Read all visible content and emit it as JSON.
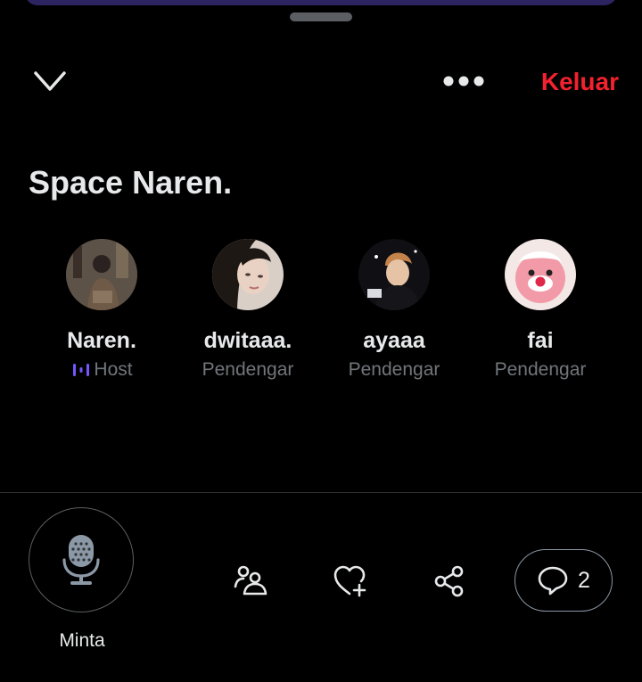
{
  "header": {
    "collapse_icon": "chevron-down-icon",
    "more_icon": "more-horizontal-icon",
    "leave_label": "Keluar",
    "leave_color": "#f4212e"
  },
  "space": {
    "title": "Space Naren."
  },
  "participants": [
    {
      "name": "Naren.",
      "role": "Host",
      "role_icon": "host-audio-icon",
      "role_color": "#7856ff"
    },
    {
      "name": "dwitaaa.",
      "role": "Pendengar"
    },
    {
      "name": "ayaaa",
      "role": "Pendengar"
    },
    {
      "name": "fai",
      "role": "Pendengar"
    }
  ],
  "footer": {
    "mic_icon": "microphone-icon",
    "mic_label": "Minta",
    "people_icon": "people-icon",
    "like_icon": "heart-plus-icon",
    "share_icon": "share-icon",
    "comments_icon": "comment-icon",
    "comments_count": "2"
  },
  "colors": {
    "background": "#000000",
    "text_primary": "#e7e9ea",
    "text_secondary": "#71767b",
    "accent_red": "#f4212e",
    "host_purple": "#7856ff"
  }
}
